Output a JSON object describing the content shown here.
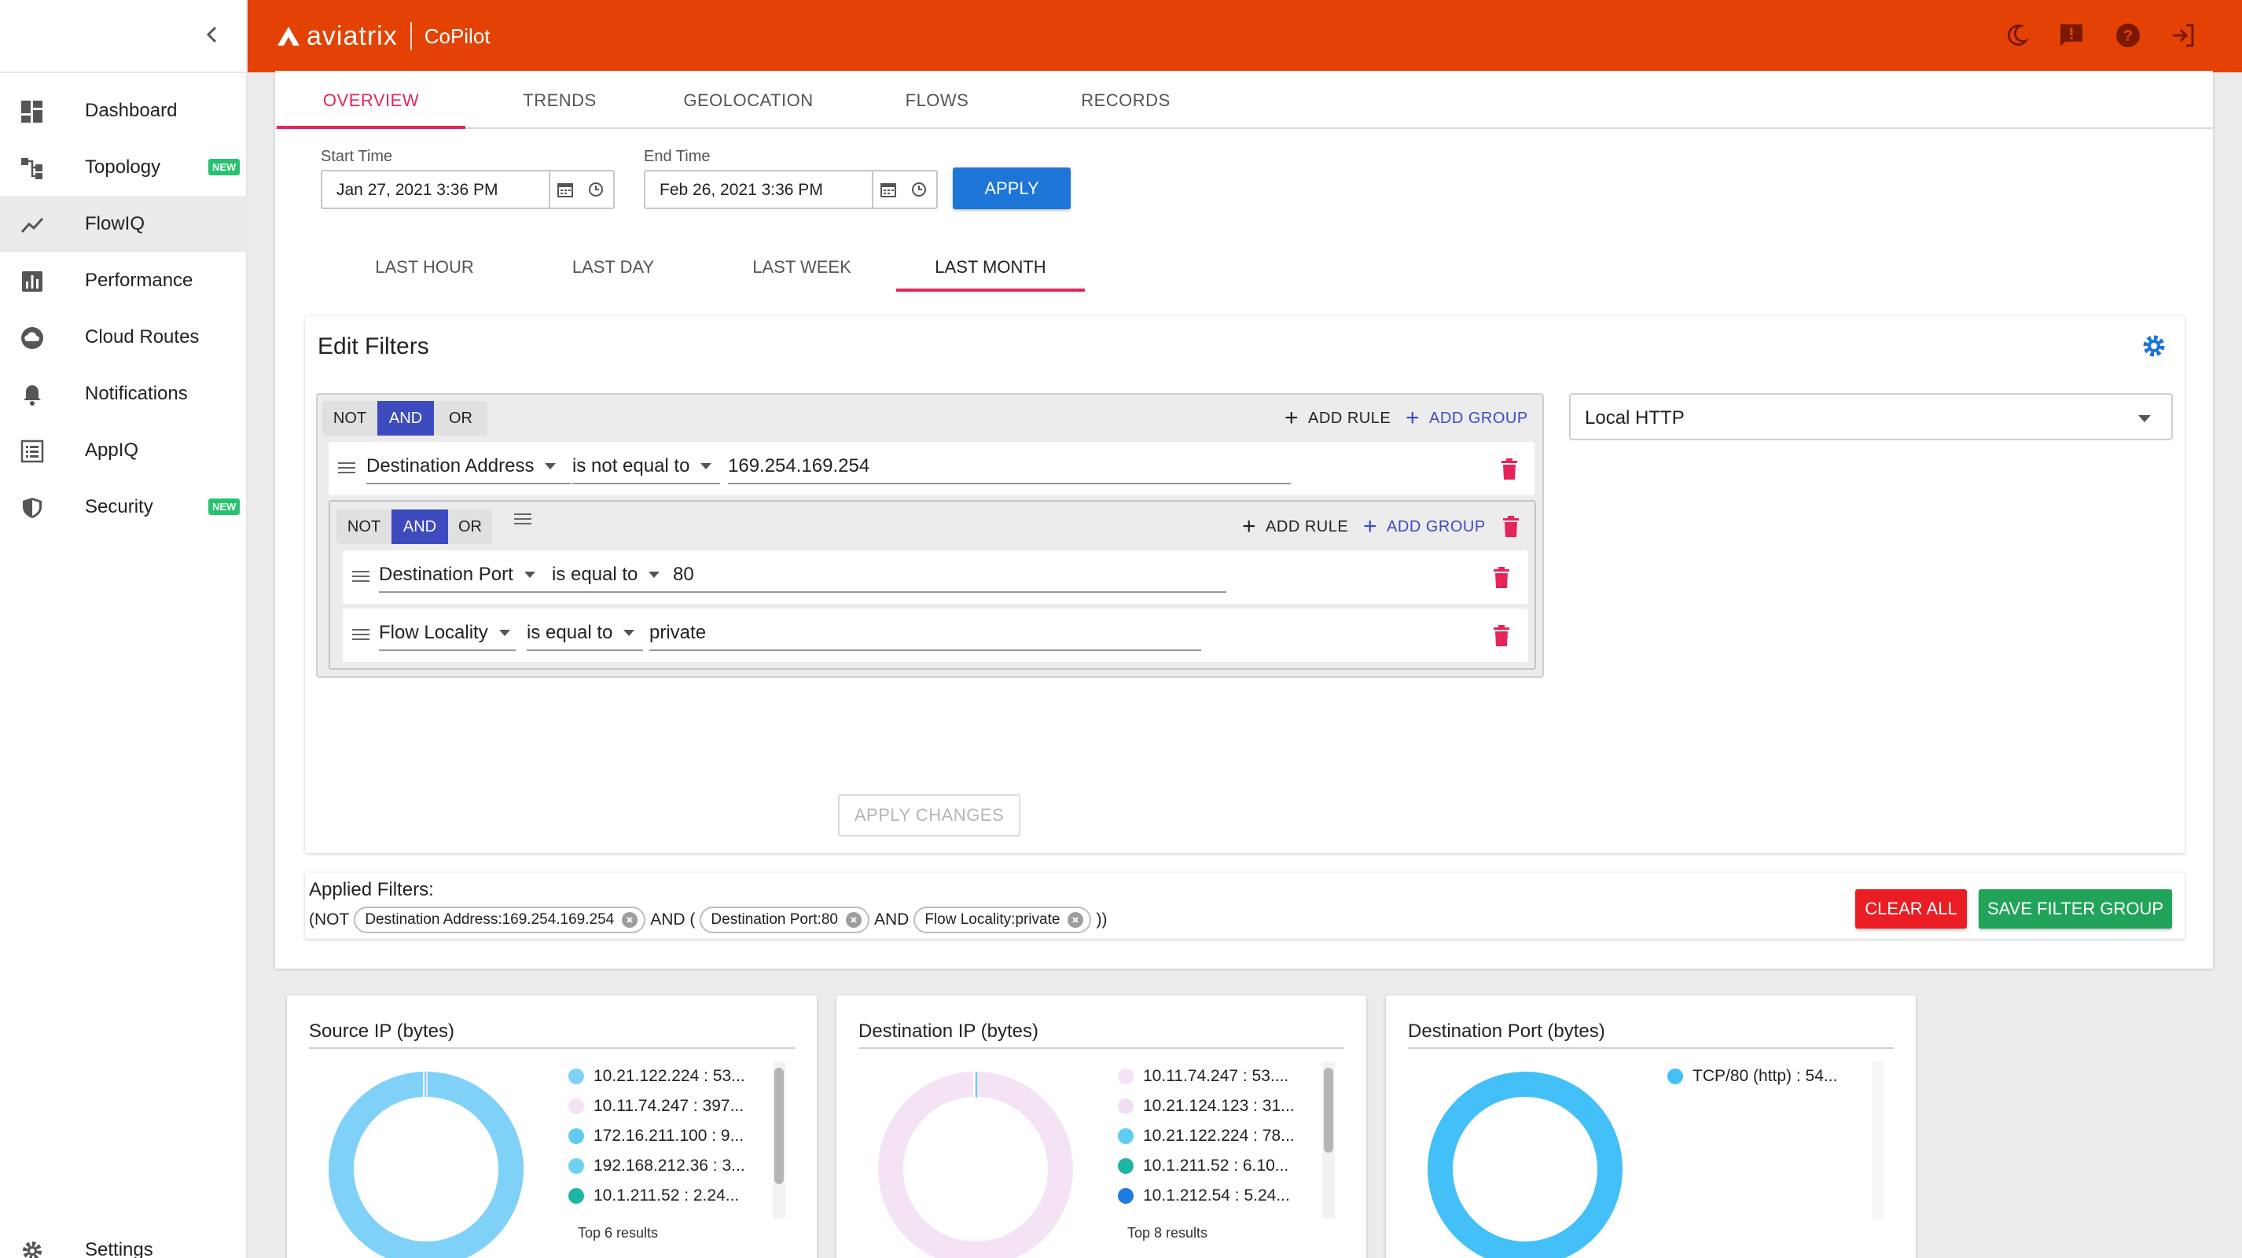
{
  "sidebar": {
    "items": [
      {
        "label": "Dashboard",
        "icon": "dashboard-icon"
      },
      {
        "label": "Topology",
        "icon": "topology-icon",
        "badge": "NEW"
      },
      {
        "label": "FlowIQ",
        "icon": "trend-icon",
        "active": true
      },
      {
        "label": "Performance",
        "icon": "bar-chart-icon"
      },
      {
        "label": "Cloud Routes",
        "icon": "cloud-icon"
      },
      {
        "label": "Notifications",
        "icon": "bell-icon"
      },
      {
        "label": "AppIQ",
        "icon": "list-icon"
      },
      {
        "label": "Security",
        "icon": "shield-icon",
        "badge": "NEW"
      }
    ],
    "settings_label": "Settings"
  },
  "header": {
    "brand": "aviatrix",
    "product": "CoPilot",
    "color": "#e34204"
  },
  "tabs": [
    "OVERVIEW",
    "TRENDS",
    "GEOLOCATION",
    "FLOWS",
    "RECORDS"
  ],
  "time": {
    "start_label": "Start Time",
    "start_value": "Jan 27, 2021 3:36 PM",
    "end_label": "End Time",
    "end_value": "Feb 26, 2021 3:36 PM",
    "apply": "APPLY"
  },
  "ranges": [
    "LAST HOUR",
    "LAST DAY",
    "LAST WEEK",
    "LAST MONTH"
  ],
  "filters": {
    "title": "Edit Filters",
    "logic": {
      "not": "NOT",
      "and": "AND",
      "or": "OR"
    },
    "add_rule": "ADD RULE",
    "add_group": "ADD GROUP",
    "rule1": {
      "field": "Destination Address",
      "op": "is not equal to",
      "value": "169.254.169.254"
    },
    "rule2": {
      "field": "Destination Port",
      "op": "is equal to",
      "value": "80"
    },
    "rule3": {
      "field": "Flow Locality",
      "op": "is equal to",
      "value": "private"
    },
    "saved_filter": "Local HTTP",
    "apply_changes": "APPLY CHANGES"
  },
  "applied": {
    "label": "Applied Filters:",
    "open": "(NOT",
    "chip1": "Destination Address:169.254.169.254",
    "and_open": "AND (",
    "chip2": "Destination Port:80",
    "and": "AND",
    "chip3": "Flow Locality:private",
    "close": "))",
    "clear_all": "CLEAR ALL",
    "save_group": "SAVE FILTER GROUP"
  },
  "charts": [
    {
      "title": "Source IP (bytes)",
      "legend": [
        {
          "label": "10.21.122.224 : 53...",
          "color": "#7fd1f7"
        },
        {
          "label": "10.11.74.247 : 397...",
          "color": "#f4e3f5"
        },
        {
          "label": "172.16.211.100 : 9...",
          "color": "#5fcdf0"
        },
        {
          "label": "192.168.212.36 : 3...",
          "color": "#6fd2f2"
        },
        {
          "label": "10.1.211.52 : 2.24...",
          "color": "#1db5a3"
        }
      ],
      "footer": "Top 6 results"
    },
    {
      "title": "Destination IP (bytes)",
      "legend": [
        {
          "label": "10.11.74.247 : 53....",
          "color": "#f4e3f5"
        },
        {
          "label": "10.21.124.123 : 31...",
          "color": "#f2def2"
        },
        {
          "label": "10.21.122.224 : 78...",
          "color": "#5fcdf0"
        },
        {
          "label": "10.1.211.52 : 6.10...",
          "color": "#1db5a3"
        },
        {
          "label": "10.1.212.54 : 5.24...",
          "color": "#1e7be0"
        }
      ],
      "footer": "Top 8 results"
    },
    {
      "title": "Destination Port (bytes)",
      "legend": [
        {
          "label": "TCP/80 (http) : 54...",
          "color": "#43c0f7"
        }
      ],
      "footer": ""
    }
  ]
}
